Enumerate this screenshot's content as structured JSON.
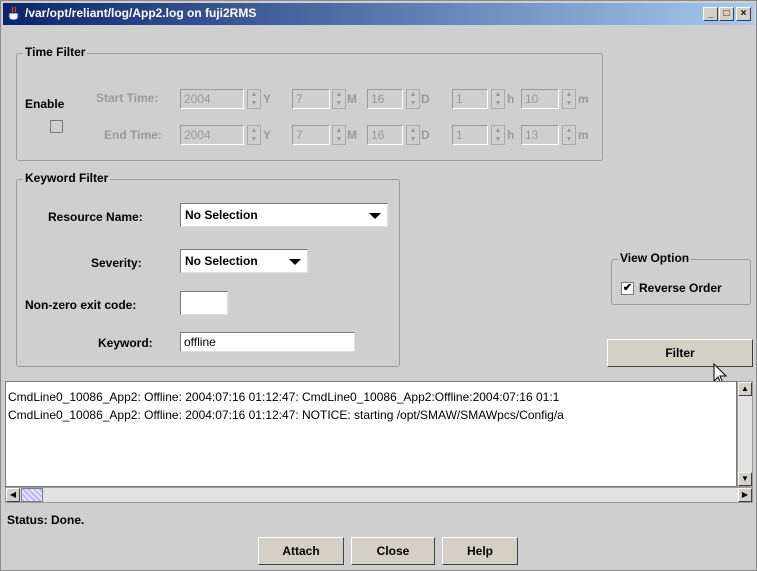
{
  "window": {
    "title": "/var/opt/reliant/log/App2.log on fuji2RMS",
    "minimize_label": "_",
    "maximize_label": "□",
    "close_label": "×"
  },
  "time_filter": {
    "title": "Time Filter",
    "enable_label": "Enable",
    "enable_checked": false,
    "start": {
      "label": "Start Time:",
      "year": "2004",
      "year_unit": "Y",
      "month": "7",
      "month_unit": "M",
      "day": "16",
      "day_unit": "D",
      "hour": "1",
      "hour_unit": "h",
      "minute": "10",
      "minute_unit": "m"
    },
    "end": {
      "label": "End Time:",
      "year": "2004",
      "year_unit": "Y",
      "month": "7",
      "month_unit": "M",
      "day": "16",
      "day_unit": "D",
      "hour": "1",
      "hour_unit": "h",
      "minute": "13",
      "minute_unit": "m"
    }
  },
  "keyword_filter": {
    "title": "Keyword Filter",
    "resource_name_label": "Resource Name:",
    "resource_name_value": "No Selection",
    "severity_label": "Severity:",
    "severity_value": "No Selection",
    "exit_code_label": "Non-zero exit code:",
    "exit_code_value": "",
    "keyword_label": "Keyword:",
    "keyword_value": "offline"
  },
  "view_option": {
    "title": "View Option",
    "reverse_order_label": "Reverse Order",
    "reverse_order_checked": true
  },
  "filter_button": "Filter",
  "log": {
    "lines": [
      "CmdLine0_10086_App2: Offline: 2004:07:16 01:12:47: CmdLine0_10086_App2:Offline:2004:07:16 01:1",
      "CmdLine0_10086_App2: Offline: 2004:07:16 01:12:47: NOTICE: starting /opt/SMAW/SMAWpcs/Config/a"
    ]
  },
  "status": "Status: Done.",
  "buttons": {
    "attach": "Attach",
    "close": "Close",
    "help": "Help"
  },
  "colors": {
    "titlebar_start": "#0a246a",
    "titlebar_end": "#a6caf0",
    "background": "#cfcfcf"
  }
}
